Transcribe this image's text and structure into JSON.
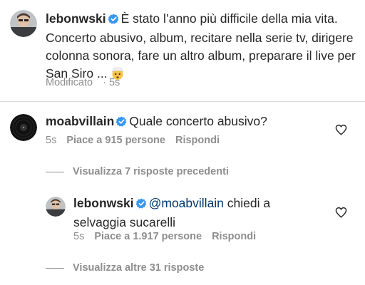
{
  "caption": {
    "username": "lebonwski",
    "text_line1": "È stato l’anno più difficile della mia vita.",
    "text_line2": "Concerto abusivo, album, recitare nella serie tv, dirigere",
    "text_line3": "colonna sonora, fare un altro album, preparare il live per",
    "text_line4": "San Siro ...",
    "emoji": "exploding-head-emoji",
    "edited_label": "Modificato",
    "time": "5s"
  },
  "comment1": {
    "username": "moabvillain",
    "text": "Quale concerto abusivo?",
    "time": "5s",
    "likes": "Piace a 915 persone",
    "reply": "Rispondi",
    "view_replies": "Visualizza 7 risposte precedenti"
  },
  "comment2": {
    "username": "lebonwski",
    "mention": "@moabvillain",
    "text_line1": "chiedi a",
    "text_line2": "selvaggia sucarelli",
    "time": "5s",
    "likes": "Piace a 1.917 persone",
    "reply": "Rispondi",
    "view_more": "Visualizza altre 31 risposte"
  },
  "colors": {
    "verified": "#3897f0",
    "mention": "#00376b",
    "secondary": "#8e8e8e"
  }
}
